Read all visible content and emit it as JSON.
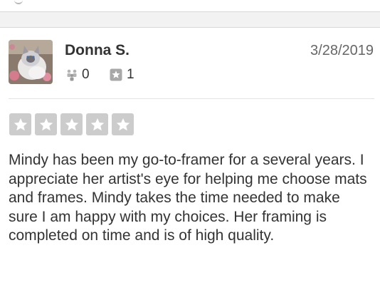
{
  "review": {
    "user_name": "Donna S.",
    "date": "3/28/2019",
    "friend_count": "0",
    "review_count": "1",
    "rating_stars": 5,
    "rating_color": "#cccccc",
    "text": "Mindy has been my go-to-framer for a several years. I appreciate her artist's eye for helping me choose mats and frames. Mindy takes the time needed to make sure I am happy with my choices. Her framing is completed on time and is of high quality."
  },
  "icons": {
    "avatar": "cat-photo-avatar",
    "friends": "friends-icon",
    "reviews": "review-star-icon",
    "rating": "star-icon"
  }
}
